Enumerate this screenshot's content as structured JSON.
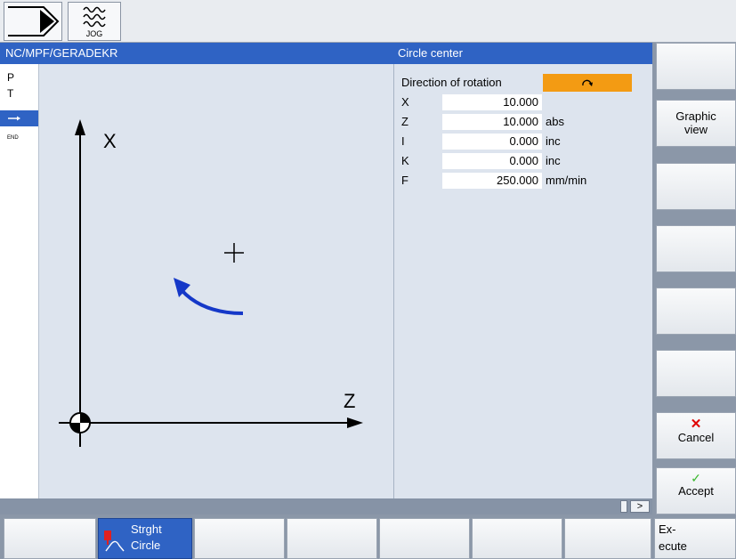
{
  "header": {
    "mode_label": "JOG",
    "path": "NC/MPF/GERADEKR",
    "form_title": "Circle center"
  },
  "left_indicators": [
    "P",
    "T",
    "END"
  ],
  "graphic": {
    "x_axis_label": "X",
    "z_axis_label": "Z"
  },
  "params": {
    "direction_label": "Direction of rotation",
    "rows": [
      {
        "label": "X",
        "value": "10.000",
        "unit": ""
      },
      {
        "label": "Z",
        "value": "10.000",
        "unit": "abs"
      },
      {
        "label": "I",
        "value": "0.000",
        "unit": "inc"
      },
      {
        "label": "K",
        "value": "0.000",
        "unit": "inc"
      },
      {
        "label": "F",
        "value": "250.000",
        "unit": "mm/min"
      }
    ]
  },
  "statusbar": {
    "more_label": ">"
  },
  "vertical_softkeys": {
    "graphic_view_line1": "Graphic",
    "graphic_view_line2": "view",
    "cancel": "Cancel",
    "accept": "Accept"
  },
  "horizontal_softkeys": {
    "strght_circle_line1": "Strght",
    "strght_circle_line2": "Circle",
    "execute_line1": "Ex-",
    "execute_line2": "ecute"
  },
  "colors": {
    "title_bar": "#2f63c4",
    "direction_button": "#f39b13",
    "rotation_arrow": "#1538c8",
    "cancel_mark": "#e00000",
    "accept_mark": "#3bb82e"
  }
}
